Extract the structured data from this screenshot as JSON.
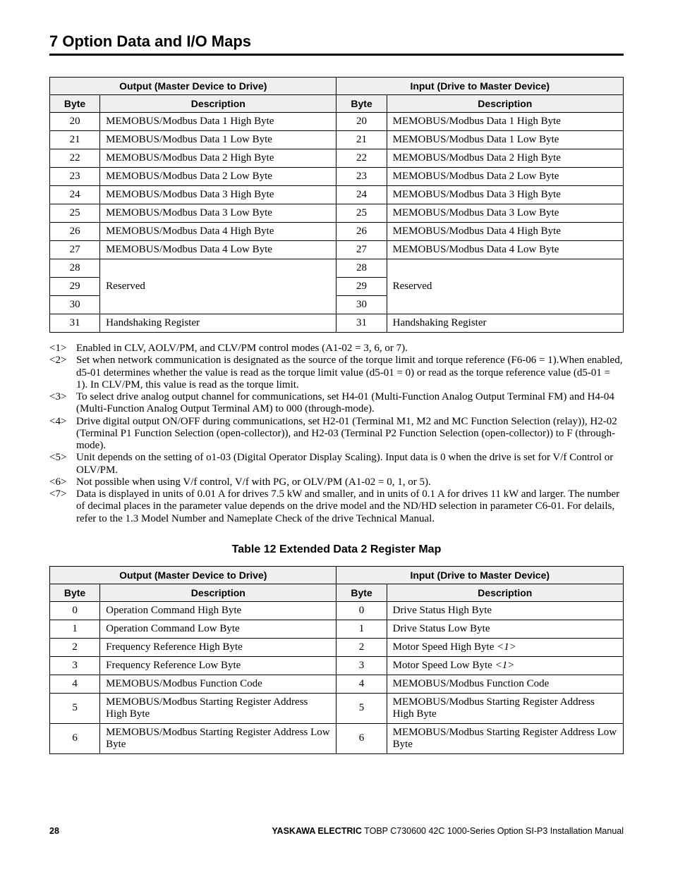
{
  "heading": "7  Option Data and I/O Maps",
  "table1": {
    "headers": {
      "out_group": "Output (Master Device to Drive)",
      "in_group": "Input (Drive to Master Device)",
      "byte": "Byte",
      "desc": "Description"
    },
    "rows": [
      {
        "ob": "20",
        "od": "MEMOBUS/Modbus Data 1 High Byte",
        "ib": "20",
        "id": "MEMOBUS/Modbus Data 1 High Byte"
      },
      {
        "ob": "21",
        "od": "MEMOBUS/Modbus Data 1 Low Byte",
        "ib": "21",
        "id": "MEMOBUS/Modbus Data 1 Low Byte"
      },
      {
        "ob": "22",
        "od": "MEMOBUS/Modbus Data 2 High Byte",
        "ib": "22",
        "id": "MEMOBUS/Modbus Data 2 High Byte"
      },
      {
        "ob": "23",
        "od": "MEMOBUS/Modbus Data 2 Low Byte",
        "ib": "23",
        "id": "MEMOBUS/Modbus Data 2 Low Byte"
      },
      {
        "ob": "24",
        "od": "MEMOBUS/Modbus Data 3 High Byte",
        "ib": "24",
        "id": "MEMOBUS/Modbus Data 3 High Byte"
      },
      {
        "ob": "25",
        "od": "MEMOBUS/Modbus Data 3 Low Byte",
        "ib": "25",
        "id": "MEMOBUS/Modbus Data 3 Low Byte"
      },
      {
        "ob": "26",
        "od": "MEMOBUS/Modbus Data 4 High Byte",
        "ib": "26",
        "id": "MEMOBUS/Modbus Data 4 High Byte"
      },
      {
        "ob": "27",
        "od": "MEMOBUS/Modbus Data 4 Low Byte",
        "ib": "27",
        "id": "MEMOBUS/Modbus Data 4 Low Byte"
      }
    ],
    "reserved_bytes": [
      "28",
      "29",
      "30"
    ],
    "reserved_label": "Reserved",
    "last": {
      "ob": "31",
      "od": "Handshaking Register",
      "ib": "31",
      "id": "Handshaking Register"
    }
  },
  "notes": [
    {
      "tag": "<1>",
      "txt": "Enabled in CLV, AOLV/PM, and CLV/PM control modes (A1-02 = 3, 6, or 7)."
    },
    {
      "tag": "<2>",
      "txt": "Set when network communication is designated as the source of the torque limit and torque reference (F6-06 = 1).When enabled, d5-01 determines whether the value is read as the torque limit value (d5-01 = 0) or read as the torque reference value (d5-01 = 1). In CLV/PM, this value is read as the torque limit."
    },
    {
      "tag": "<3>",
      "txt": "To select drive analog output channel for communications, set H4-01 (Multi-Function Analog Output Terminal FM) and H4-04 (Multi-Function Analog Output Terminal AM) to 000 (through-mode)."
    },
    {
      "tag": "<4>",
      "txt": "Drive digital output ON/OFF during communications, set H2-01 (Terminal M1, M2 and MC Function Selection (relay)), H2-02 (Terminal P1 Function Selection (open-collector)), and H2-03 (Terminal P2 Function Selection (open-collector)) to F (through-mode)."
    },
    {
      "tag": "<5>",
      "txt": "Unit depends on the setting of o1-03 (Digital Operator Display Scaling). Input data is 0 when the drive is set for V/f Control or OLV/PM."
    },
    {
      "tag": "<6>",
      "txt": "Not possible when using V/f control, V/f with PG, or OLV/PM (A1-02 = 0, 1, or 5)."
    },
    {
      "tag": "<7>",
      "txt": "Data is displayed in units of 0.01 A for drives 7.5 kW and smaller, and in units of 0.1 A for drives 11 kW and larger. The number of decimal places in the parameter value depends on the drive model and the ND/HD selection in parameter C6-01. For delails, refer to the 1.3 Model Number and Nameplate Check of the drive Technical Manual."
    }
  ],
  "table2_caption": "Table 12  Extended Data 2 Register Map",
  "table2": {
    "headers": {
      "out_group": "Output (Master Device to Drive)",
      "in_group": "Input (Drive to Master Device)",
      "byte": "Byte",
      "desc": "Description"
    },
    "rows": [
      {
        "ob": "0",
        "od": "Operation Command High Byte",
        "ib": "0",
        "id": "Drive Status High Byte"
      },
      {
        "ob": "1",
        "od": "Operation Command Low Byte",
        "ib": "1",
        "id": "Drive Status Low Byte"
      },
      {
        "ob": "2",
        "od": "Frequency Reference High Byte",
        "ib": "2",
        "id": "Motor Speed High Byte ",
        "ref": "<1>"
      },
      {
        "ob": "3",
        "od": "Frequency Reference Low Byte",
        "ib": "3",
        "id": "Motor Speed Low Byte ",
        "ref": "<1>"
      },
      {
        "ob": "4",
        "od": "MEMOBUS/Modbus Function Code",
        "ib": "4",
        "id": "MEMOBUS/Modbus Function Code"
      },
      {
        "ob": "5",
        "od": "MEMOBUS/Modbus Starting Register Address High Byte",
        "ib": "5",
        "id": "MEMOBUS/Modbus Starting Register Address High Byte"
      },
      {
        "ob": "6",
        "od": "MEMOBUS/Modbus Starting Register Address Low Byte",
        "ib": "6",
        "id": "MEMOBUS/Modbus Starting Register Address Low Byte"
      }
    ]
  },
  "footer": {
    "page": "28",
    "brand": "YASKAWA ELECTRIC",
    "rest": " TOBP C730600 42C 1000-Series Option SI-P3 Installation Manual"
  }
}
